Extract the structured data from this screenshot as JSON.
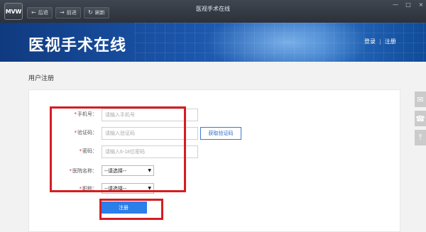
{
  "browser": {
    "logo": "MVW",
    "back_label": "后退",
    "forward_label": "前进",
    "refresh_label": "刷新",
    "window_title": "医视手术在线"
  },
  "site": {
    "title": "医视手术在线",
    "login_label": "登录",
    "separator": "|",
    "register_label": "注册"
  },
  "page": {
    "title": "用户注册"
  },
  "form": {
    "required_mark": "*",
    "phone": {
      "label": "手机号：",
      "placeholder": "请输入手机号"
    },
    "code": {
      "label": "验证码：",
      "placeholder": "请输入验证码",
      "button": "获取验证码"
    },
    "password": {
      "label": "密码：",
      "placeholder": "请输入6-18位密码"
    },
    "hospital": {
      "label": "医院名称：",
      "selected": "--请选择--"
    },
    "title": {
      "label": "职称：",
      "selected": "--请选择--"
    },
    "submit_label": "注册"
  },
  "colors": {
    "highlight": "#d51d22",
    "primary": "#2c7ee8",
    "banner": "#1b56ac"
  },
  "icons": {
    "side_chat": "chat-icon",
    "side_phone": "phone-icon",
    "side_top": "back-to-top-icon"
  }
}
